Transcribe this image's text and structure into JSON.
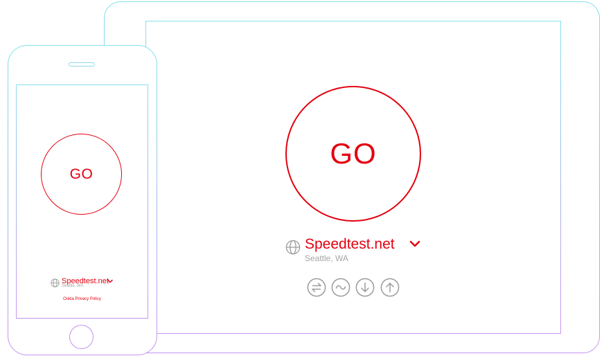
{
  "colors": {
    "accent": "#e3000f",
    "muted_text": "#a5a5a5",
    "icon_gray": "#9b9b9b",
    "frame_gradient_top": "#7fe3ec",
    "frame_gradient_bottom": "#c893ef"
  },
  "tablet": {
    "go_label": "GO",
    "server_name": "Speedtest.net",
    "server_location": "Seattle, WA",
    "icons": [
      "connections-icon",
      "ping-icon",
      "download-icon",
      "upload-icon"
    ]
  },
  "phone": {
    "go_label": "GO",
    "server_name": "Speedtest.net",
    "server_location": "Seattle, WA",
    "privacy_link": "Ookla Privacy Policy"
  }
}
